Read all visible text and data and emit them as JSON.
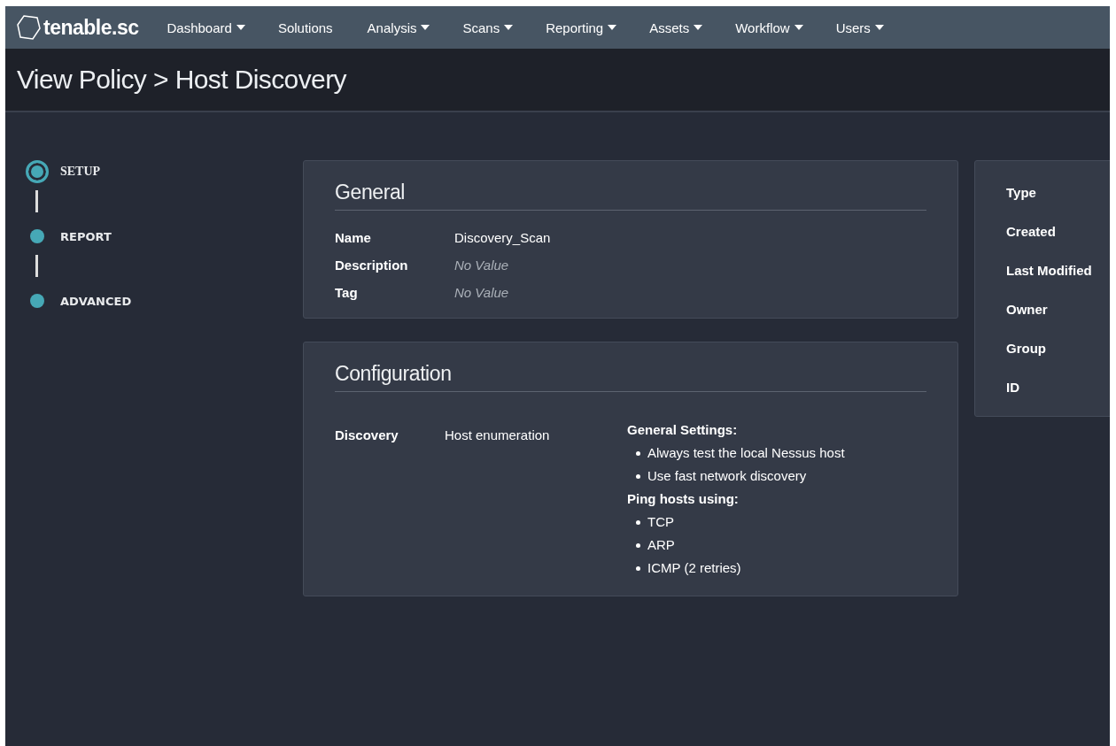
{
  "nav": {
    "logo": "tenable.sc",
    "items": [
      {
        "label": "Dashboard",
        "dropdown": true
      },
      {
        "label": "Solutions",
        "dropdown": false
      },
      {
        "label": "Analysis",
        "dropdown": true
      },
      {
        "label": "Scans",
        "dropdown": true
      },
      {
        "label": "Reporting",
        "dropdown": true
      },
      {
        "label": "Assets",
        "dropdown": true
      },
      {
        "label": "Workflow",
        "dropdown": true
      },
      {
        "label": "Users",
        "dropdown": true
      }
    ]
  },
  "page_title": "View Policy > Host Discovery",
  "steps": [
    {
      "label": "SETUP",
      "selected": true
    },
    {
      "label": "REPORT",
      "selected": false
    },
    {
      "label": "ADVANCED",
      "selected": false
    }
  ],
  "general": {
    "title": "General",
    "rows": [
      {
        "label": "Name",
        "value": "Discovery_Scan",
        "empty": false
      },
      {
        "label": "Description",
        "value": "No Value",
        "empty": true
      },
      {
        "label": "Tag",
        "value": "No Value",
        "empty": true
      }
    ]
  },
  "configuration": {
    "title": "Configuration",
    "label": "Discovery",
    "value": "Host enumeration",
    "groups": [
      {
        "heading": "General Settings:",
        "items": [
          "Always test the local Nessus host",
          "Use fast network discovery"
        ]
      },
      {
        "heading": "Ping hosts using:",
        "items": [
          "TCP",
          "ARP",
          "ICMP (2 retries)"
        ]
      }
    ]
  },
  "details": {
    "labels": [
      "Type",
      "Created",
      "Last Modified",
      "Owner",
      "Group",
      "ID"
    ]
  }
}
